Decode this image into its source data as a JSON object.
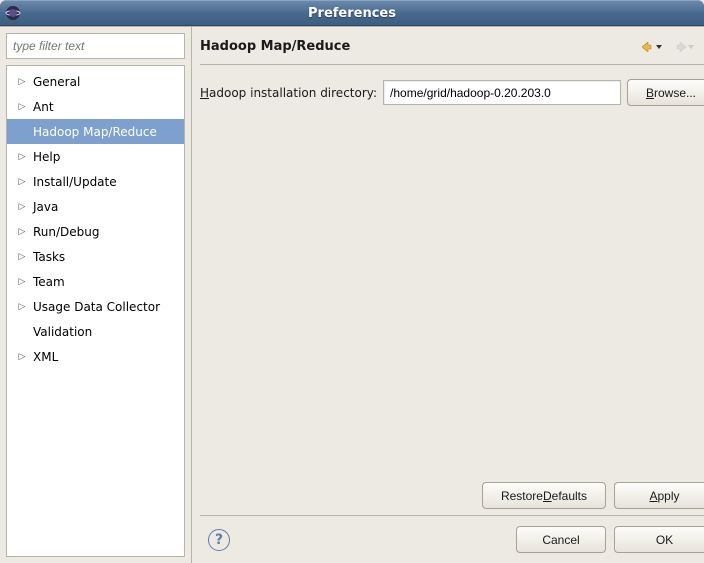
{
  "window": {
    "title": "Preferences"
  },
  "filter": {
    "placeholder": "type filter text"
  },
  "tree": {
    "items": [
      {
        "label": "General",
        "expandable": true,
        "selected": false
      },
      {
        "label": "Ant",
        "expandable": true,
        "selected": false
      },
      {
        "label": "Hadoop Map/Reduce",
        "expandable": false,
        "selected": true
      },
      {
        "label": "Help",
        "expandable": true,
        "selected": false
      },
      {
        "label": "Install/Update",
        "expandable": true,
        "selected": false
      },
      {
        "label": "Java",
        "expandable": true,
        "selected": false
      },
      {
        "label": "Run/Debug",
        "expandable": true,
        "selected": false
      },
      {
        "label": "Tasks",
        "expandable": true,
        "selected": false
      },
      {
        "label": "Team",
        "expandable": true,
        "selected": false
      },
      {
        "label": "Usage Data Collector",
        "expandable": true,
        "selected": false
      },
      {
        "label": "Validation",
        "expandable": false,
        "selected": false
      },
      {
        "label": "XML",
        "expandable": true,
        "selected": false
      }
    ]
  },
  "page": {
    "title": "Hadoop Map/Reduce",
    "install_dir_label_pre": "H",
    "install_dir_label_post": "adoop installation directory:",
    "install_dir_value": "/home/grid/hadoop-0.20.203.0",
    "browse_pre": "B",
    "browse_post": "rowse...",
    "restore_defaults_pre": "Restore ",
    "restore_defaults_u": "D",
    "restore_defaults_post": "efaults",
    "apply_pre": "",
    "apply_u": "A",
    "apply_post": "pply"
  },
  "dialog": {
    "cancel": "Cancel",
    "ok": "OK"
  },
  "icons": {
    "help": "?"
  }
}
